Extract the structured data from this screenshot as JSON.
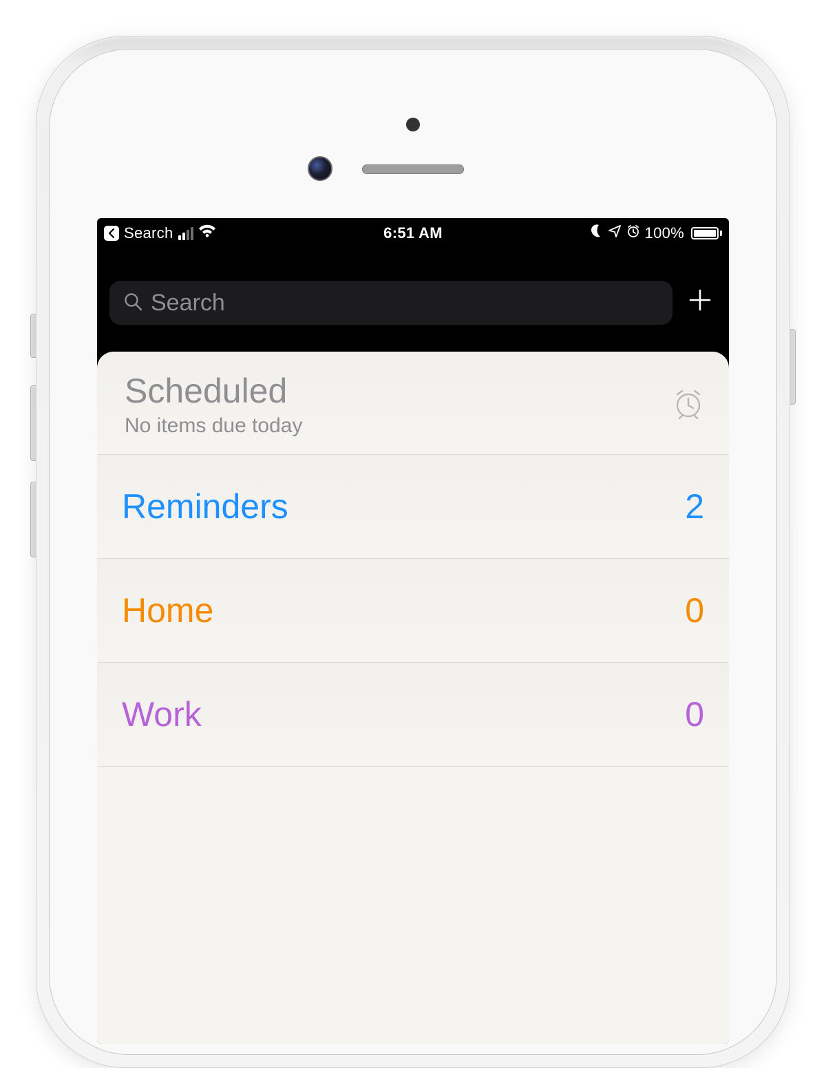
{
  "status": {
    "back_label": "Search",
    "time": "6:51 AM",
    "battery_pct": "100%"
  },
  "search": {
    "placeholder": "Search"
  },
  "scheduled": {
    "title": "Scheduled",
    "subtitle": "No items due today"
  },
  "lists": [
    {
      "name": "Reminders",
      "count": "2",
      "colorClass": "c-blue"
    },
    {
      "name": "Home",
      "count": "0",
      "colorClass": "c-orange"
    },
    {
      "name": "Work",
      "count": "0",
      "colorClass": "c-purple"
    }
  ]
}
